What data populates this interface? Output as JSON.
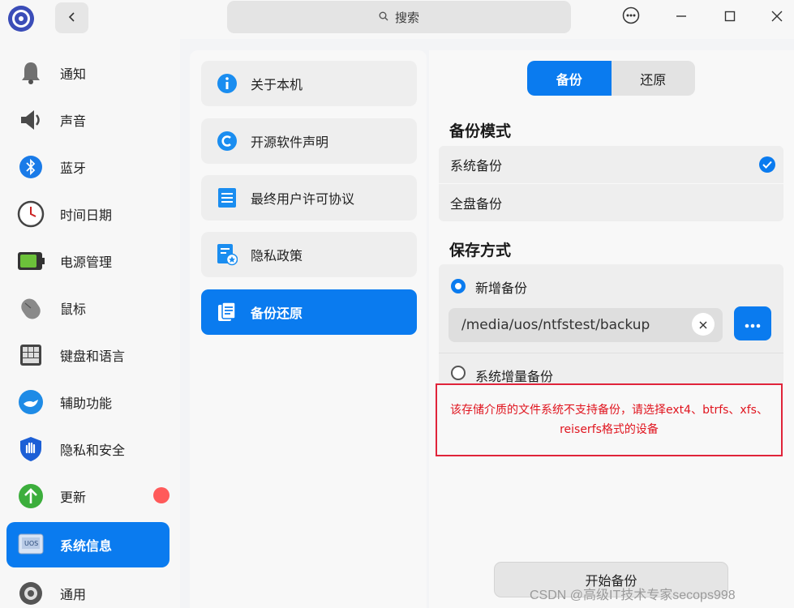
{
  "titlebar": {
    "search_placeholder": "搜索",
    "icons": [
      "app-logo-icon",
      "chevron-left-icon",
      "search-icon",
      "more-icon",
      "minimize-icon",
      "maximize-icon",
      "close-icon"
    ]
  },
  "sidebar": {
    "items": [
      {
        "label": "通知",
        "icon": "bell-icon"
      },
      {
        "label": "声音",
        "icon": "speaker-icon"
      },
      {
        "label": "蓝牙",
        "icon": "bluetooth-icon"
      },
      {
        "label": "时间日期",
        "icon": "clock-icon"
      },
      {
        "label": "电源管理",
        "icon": "battery-icon"
      },
      {
        "label": "鼠标",
        "icon": "mouse-icon"
      },
      {
        "label": "键盘和语言",
        "icon": "keyboard-icon"
      },
      {
        "label": "辅助功能",
        "icon": "accessibility-icon"
      },
      {
        "label": "隐私和安全",
        "icon": "shield-icon"
      },
      {
        "label": "更新",
        "icon": "update-icon",
        "badge": true
      },
      {
        "label": "系统信息",
        "icon": "system-info-icon",
        "active": true
      },
      {
        "label": "通用",
        "icon": "gear-icon"
      }
    ]
  },
  "middle": {
    "items": [
      {
        "label": "关于本机",
        "icon": "info-icon"
      },
      {
        "label": "开源软件声明",
        "icon": "copyright-icon"
      },
      {
        "label": "最终用户许可协议",
        "icon": "document-icon"
      },
      {
        "label": "隐私政策",
        "icon": "privacy-policy-icon"
      },
      {
        "label": "备份还原",
        "icon": "backup-icon",
        "active": true
      }
    ]
  },
  "right": {
    "tabs": {
      "backup": "备份",
      "restore": "还原"
    },
    "backup_mode_title": "备份模式",
    "backup_modes": [
      {
        "label": "系统备份",
        "checked": true
      },
      {
        "label": "全盘备份",
        "checked": false
      }
    ],
    "save_method_title": "保存方式",
    "new_backup_label": "新增备份",
    "path_value": "/media/uos/ntfstest/backup",
    "incremental_label": "系统增量备份",
    "warning": "该存储介质的文件系统不支持备份，请选择ext4、btrfs、xfs、reiserfs格式的设备",
    "start_button": "开始备份"
  },
  "watermark": "CSDN @高级IT技术专家secops998",
  "colors": {
    "accent": "#0a7bef",
    "warning": "#e0141e",
    "badge": "#ff5a5a"
  }
}
